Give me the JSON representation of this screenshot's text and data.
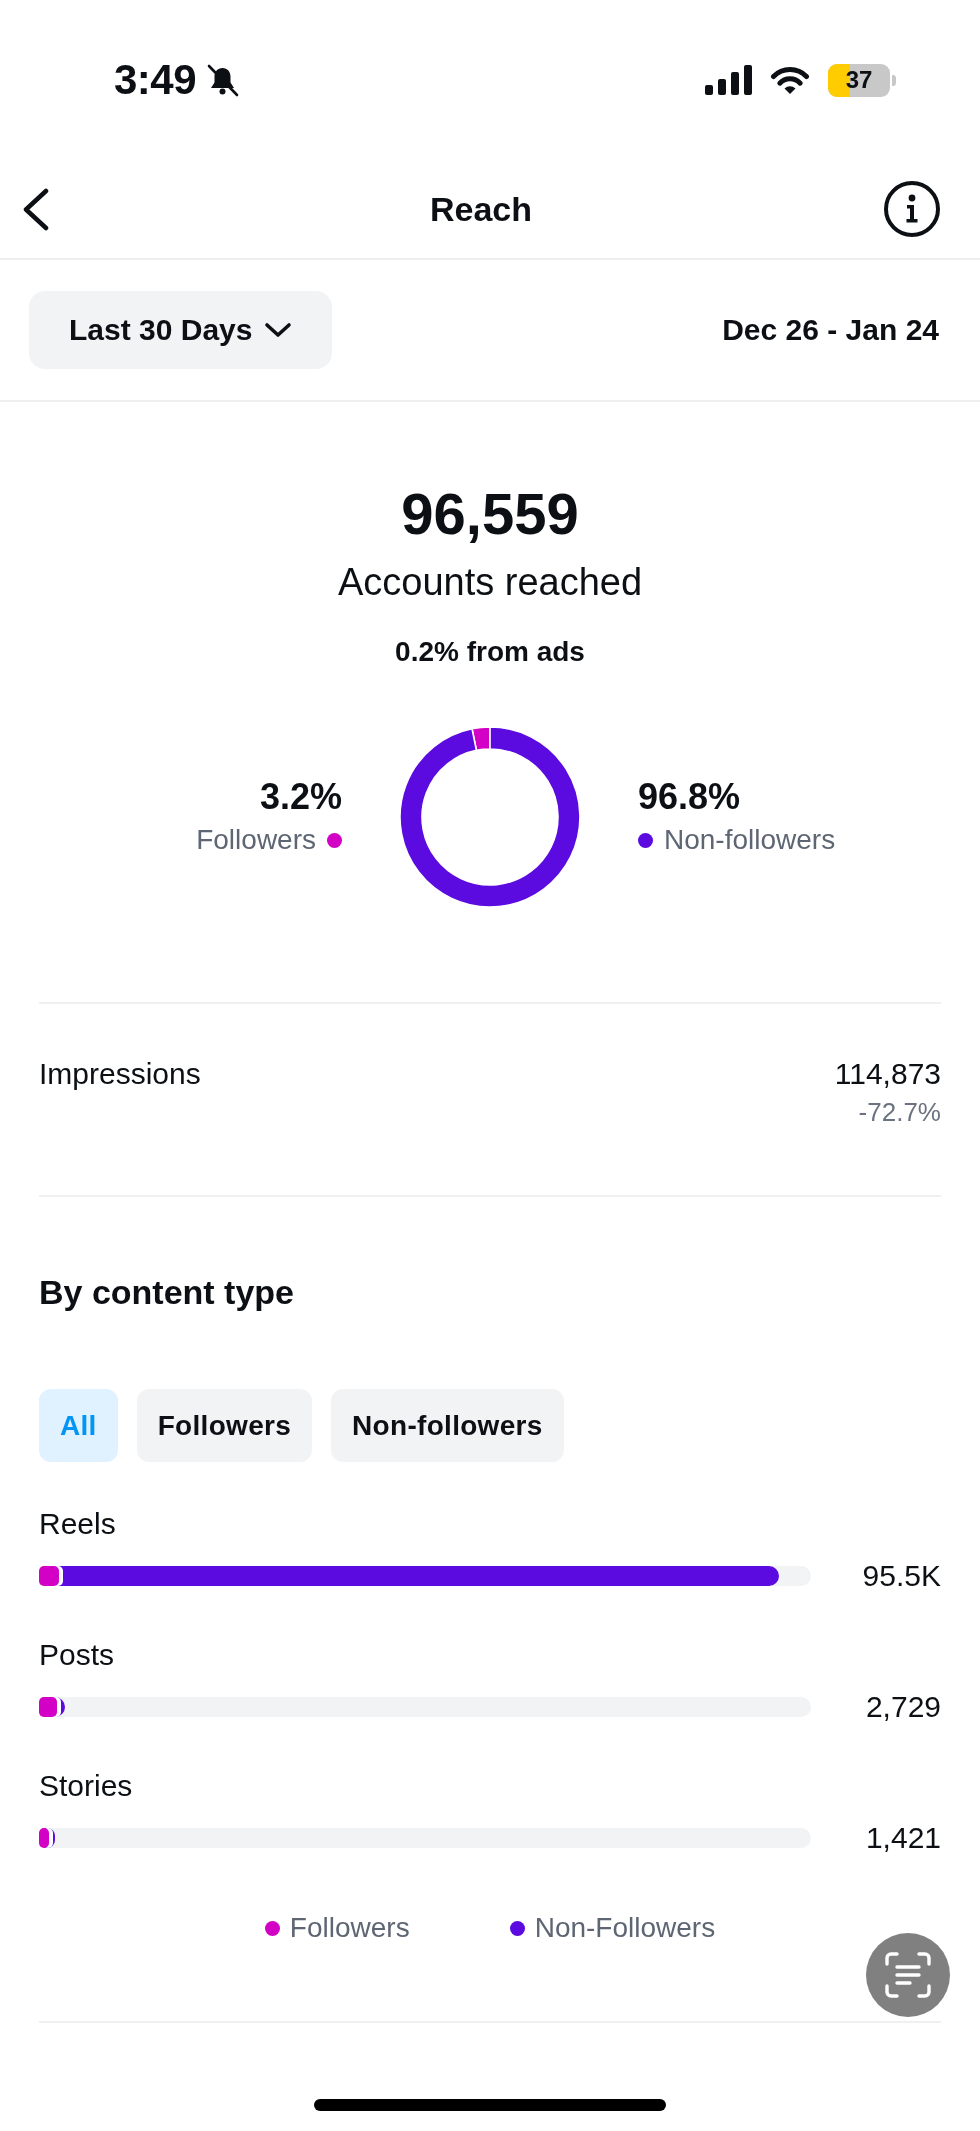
{
  "status_bar": {
    "time": "3:49",
    "battery": "37"
  },
  "header": {
    "title": "Reach"
  },
  "date_filter": {
    "range": "Last 30 Days",
    "dates": "Dec 26 - Jan 24"
  },
  "summary": {
    "value": "96,559",
    "label": "Accounts reached",
    "ads_note": "0.2% from ads",
    "chart_data": {
      "type": "donut",
      "categories": [
        "Followers",
        "Non-followers"
      ],
      "values": [
        3.2,
        96.8
      ],
      "value_labels": [
        "3.2%",
        "96.8%"
      ]
    },
    "legend_dots": [
      {
        "color": "#d300c5"
      },
      {
        "color": "#5b0ae0"
      }
    ]
  },
  "impressions": {
    "label": "Impressions",
    "value": "114,873",
    "change": "-72.7%"
  },
  "content_type": {
    "title": "By content type",
    "tabs": [
      {
        "label": "All",
        "selected": true
      },
      {
        "label": "Followers",
        "selected": false
      },
      {
        "label": "Non-followers",
        "selected": false
      }
    ],
    "rows": [
      {
        "label": "Reels",
        "value": "95.5K",
        "segments": [
          {
            "level": 0.026
          },
          {
            "level": 0.958
          }
        ]
      },
      {
        "label": "Posts",
        "value": "2,729",
        "segments": [
          {
            "level": 0.023
          },
          {
            "level": 0.034
          }
        ]
      },
      {
        "label": "Stories",
        "value": "1,421",
        "segments": [
          {
            "level": 0.013
          },
          {
            "level": 0.021
          }
        ]
      }
    ],
    "legend": [
      {
        "label": "Followers",
        "color": "#d300c5"
      },
      {
        "label": "Non-Followers",
        "color": "#5b0ae0"
      }
    ]
  }
}
